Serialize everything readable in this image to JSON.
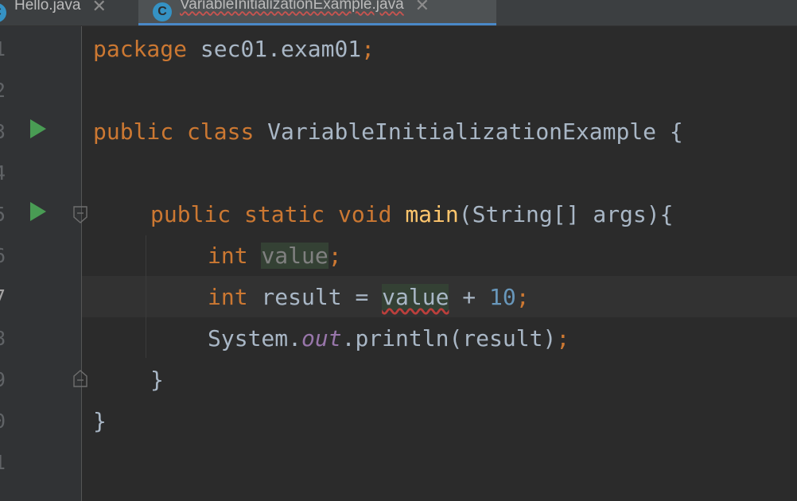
{
  "tabs": [
    {
      "label": "Hello.java",
      "icon": "java-class-icon",
      "icon_letter": "C",
      "active": false
    },
    {
      "label": "VariableInitializationExample.java",
      "icon": "java-class-icon",
      "icon_letter": "C",
      "active": true
    }
  ],
  "close_glyph": "✕",
  "current_line": 7,
  "line_numbers": [
    "1",
    "2",
    "3",
    "4",
    "5",
    "6",
    "7",
    "8",
    "9",
    "0",
    "1"
  ],
  "code": {
    "l1": {
      "kw": "package",
      "rest": " sec01.exam01",
      "semi": ";"
    },
    "l3": {
      "kw1": "public",
      "kw2": "class",
      "name": " VariableInitializationExample {"
    },
    "l5": {
      "kw1": "public",
      "kw2": "static",
      "kw3": "void",
      "fn": "main",
      "rest": "(String[] args){"
    },
    "l6": {
      "kw": "int",
      "var": "value",
      "semi": ";"
    },
    "l7": {
      "kw": "int",
      "a": " result = ",
      "var": "value",
      "b": " + ",
      "num": "10",
      "semi": ";"
    },
    "l8": {
      "a": "System.",
      "field": "out",
      "b": ".println(result)",
      "semi": ";"
    },
    "l9": {
      "brace": "}"
    },
    "l10": {
      "brace": "}"
    }
  },
  "colors": {
    "background": "#2b2b2b",
    "keyword": "#cc7832",
    "function": "#ffc66d",
    "number": "#6897bb",
    "static_field": "#9876aa",
    "run_icon": "#499c54",
    "error_underline": "#bc3f3c"
  }
}
